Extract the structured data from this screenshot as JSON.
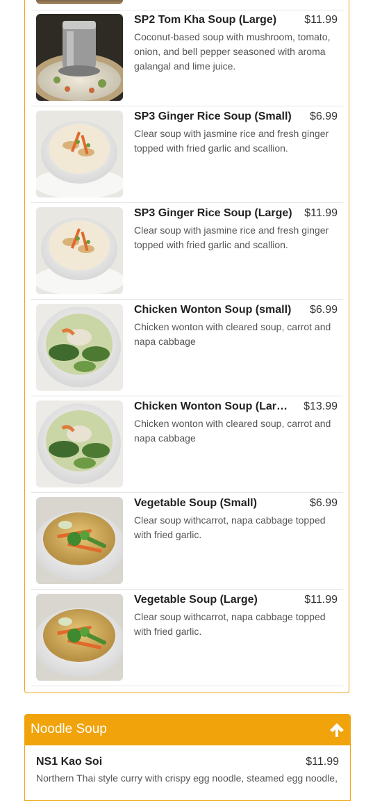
{
  "colors": {
    "accent": "#f0a30a",
    "divider": "#e4e4e4",
    "text": "#333333"
  },
  "menu_items": [
    {
      "title": "SP2 Tom Kha Soup (Large)",
      "price": "$11.99",
      "description": "Coconut-based soup with mushroom, tomato, onion, and bell pepper seasoned with aroma galangal and lime juice.",
      "image_icon": "tom-kha-soup-photo"
    },
    {
      "title": "SP3 Ginger Rice Soup (Small)",
      "price": "$6.99",
      "description": "Clear soup with jasmine rice and fresh ginger topped with fried garlic and scallion.",
      "image_icon": "ginger-rice-soup-photo"
    },
    {
      "title": "SP3 Ginger Rice Soup (Large)",
      "price": "$11.99",
      "description": "Clear soup with jasmine rice and fresh ginger topped with fried garlic and scallion.",
      "image_icon": "ginger-rice-soup-photo"
    },
    {
      "title": "Chicken Wonton Soup (small)",
      "price": "$6.99",
      "description": "Chicken wonton with cleared soup, carrot and napa cabbage",
      "image_icon": "wonton-soup-photo"
    },
    {
      "title": "Chicken Wonton Soup (Large)",
      "price": "$13.99",
      "description": "Chicken wonton with cleared soup, carrot and napa cabbage",
      "image_icon": "wonton-soup-photo"
    },
    {
      "title": "Vegetable Soup (Small)",
      "price": "$6.99",
      "description": "Clear soup withcarrot, napa cabbage topped with fried garlic.",
      "image_icon": "vegetable-soup-photo"
    },
    {
      "title": "Vegetable Soup (Large)",
      "price": "$11.99",
      "description": "Clear soup withcarrot, napa cabbage topped with fried garlic.",
      "image_icon": "vegetable-soup-photo"
    }
  ],
  "noodle_section": {
    "title": "Noodle Soup",
    "icon": "arrow-up-icon",
    "items": [
      {
        "title": "NS1 Kao Soi",
        "price": "$11.99",
        "description": "Northern Thai style curry with crispy egg noodle, steamed egg noodle,"
      }
    ]
  }
}
